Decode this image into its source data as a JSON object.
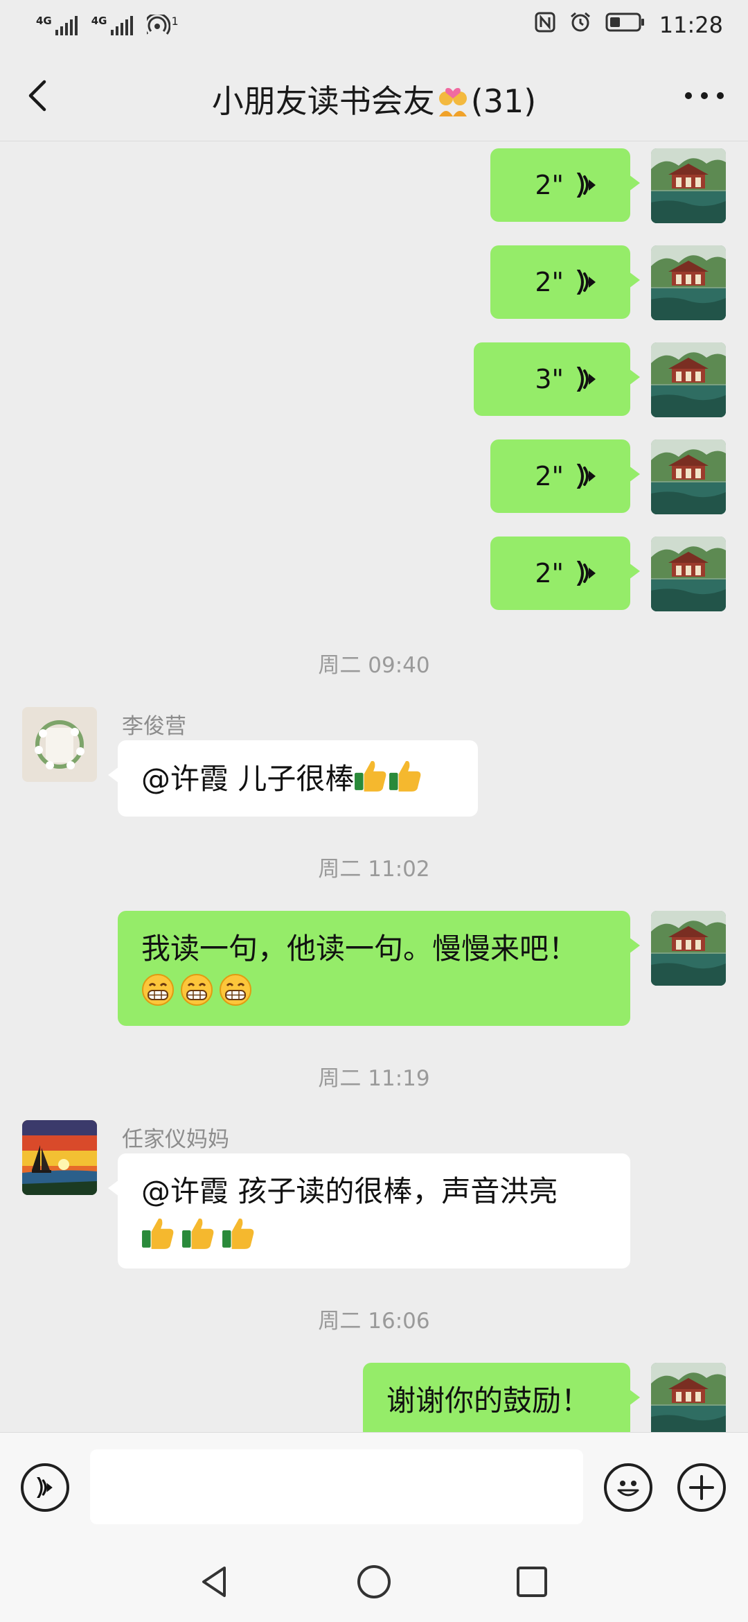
{
  "status_bar": {
    "network1": "4G",
    "network2": "4G",
    "hotspot_count": "1",
    "time": "11:28"
  },
  "header": {
    "title": "小朋友读书会友",
    "member_count": "(31)"
  },
  "messages": {
    "voices": [
      "2\"",
      "2\"",
      "3\"",
      "2\"",
      "2\""
    ],
    "time1": "周二 09:40",
    "m1": {
      "sender": "李俊营",
      "text": "@许霞  儿子很棒"
    },
    "time2": "周二 11:02",
    "m2": {
      "text": "我读一句，他读一句。慢慢来吧！"
    },
    "time3": "周二 11:19",
    "m3": {
      "sender": "任家仪妈妈",
      "text": "@许霞  孩子读的很棒，声音洪亮"
    },
    "time4": "周二 16:06",
    "m4": {
      "text": "谢谢你的鼓励！"
    }
  },
  "input": {
    "placeholder": ""
  },
  "colors": {
    "my_bubble": "#95ec69",
    "other_bubble": "#ffffff",
    "background": "#ededed"
  },
  "icons": [
    "back-arrow-icon",
    "more-icon",
    "voice-message-icon",
    "voice-input-icon",
    "emoji-icon",
    "add-icon",
    "nav-back-icon",
    "nav-home-icon",
    "nav-recents-icon"
  ]
}
